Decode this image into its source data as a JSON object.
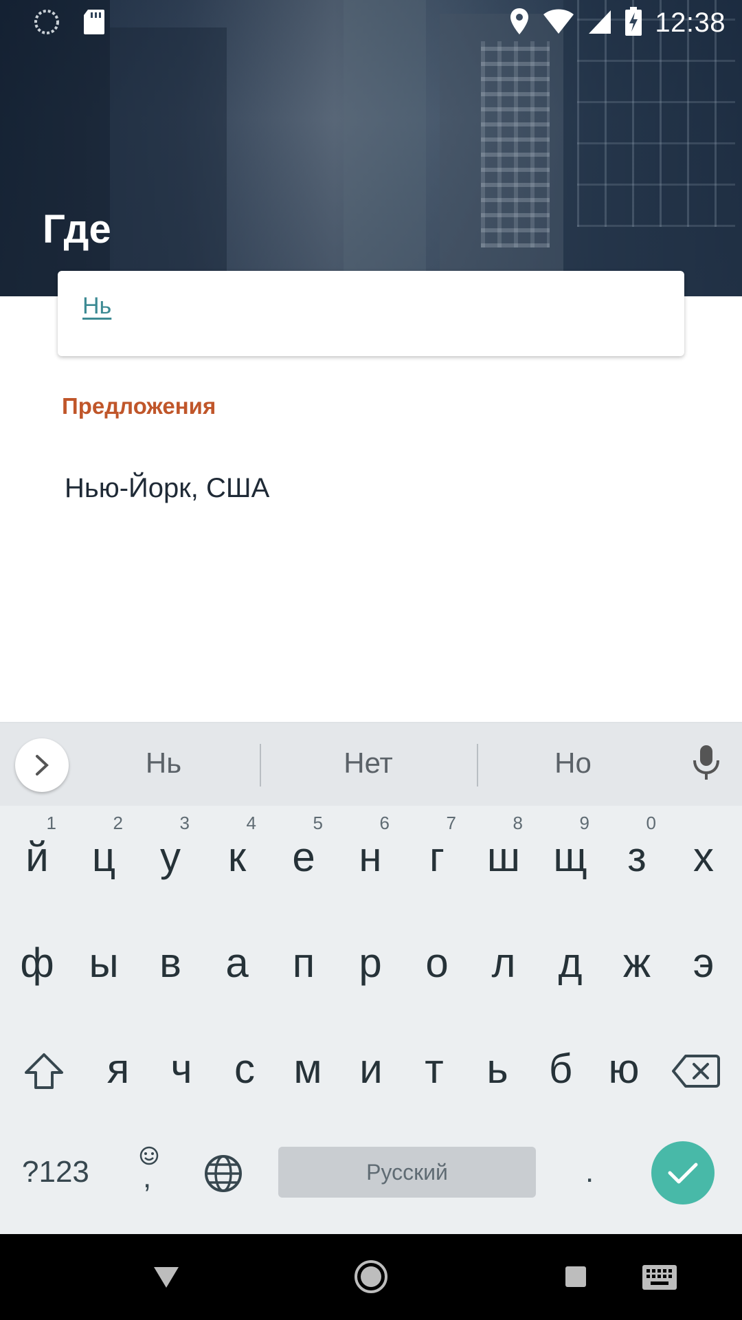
{
  "status_bar": {
    "time": "12:38",
    "icons": [
      "loading-icon",
      "sd-card-icon",
      "location-icon",
      "wifi-icon",
      "signal-icon",
      "battery-charging-icon"
    ]
  },
  "screen": {
    "title": "Где",
    "search_value": "Нь",
    "suggestions_header": "Предложения",
    "suggestions": [
      "Нью-Йорк, США"
    ]
  },
  "keyboard": {
    "suggestions": [
      "Нь",
      "Нет",
      "Но"
    ],
    "row1": [
      {
        "k": "й",
        "h": "1"
      },
      {
        "k": "ц",
        "h": "2"
      },
      {
        "k": "у",
        "h": "3"
      },
      {
        "k": "к",
        "h": "4"
      },
      {
        "k": "е",
        "h": "5"
      },
      {
        "k": "н",
        "h": "6"
      },
      {
        "k": "г",
        "h": "7"
      },
      {
        "k": "ш",
        "h": "8"
      },
      {
        "k": "щ",
        "h": "9"
      },
      {
        "k": "з",
        "h": "0"
      },
      {
        "k": "х",
        "h": ""
      }
    ],
    "row2": [
      "ф",
      "ы",
      "в",
      "а",
      "п",
      "р",
      "о",
      "л",
      "д",
      "ж",
      "э"
    ],
    "row3": [
      "я",
      "ч",
      "с",
      "м",
      "и",
      "т",
      "ь",
      "б",
      "ю"
    ],
    "symbols_label": "?123",
    "emoji_comma": ",",
    "space_label": "Русский",
    "period": ".",
    "accent_color": "#48b9a8"
  },
  "colors": {
    "suggestion_header": "#c0562a",
    "search_text": "#3c8a93"
  }
}
